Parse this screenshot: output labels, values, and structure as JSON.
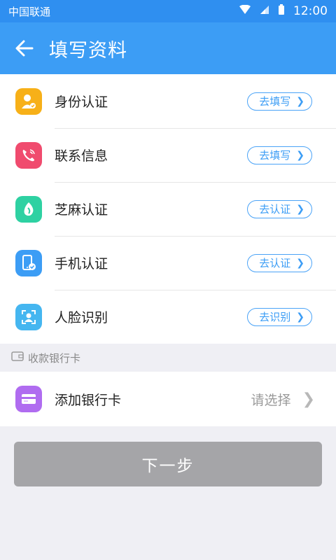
{
  "statusbar": {
    "carrier": "中国联通",
    "time": "12:00"
  },
  "appbar": {
    "title": "填写资料"
  },
  "items": [
    {
      "label": "身份认证",
      "action": "去填写",
      "icon": "id-card-icon",
      "color": "#f7b018"
    },
    {
      "label": "联系信息",
      "action": "去填写",
      "icon": "phone-contact-icon",
      "color": "#f04b6e"
    },
    {
      "label": "芝麻认证",
      "action": "去认证",
      "icon": "sesame-icon",
      "color": "#2ed1a2"
    },
    {
      "label": "手机认证",
      "action": "去认证",
      "icon": "mobile-verify-icon",
      "color": "#3c9df5"
    },
    {
      "label": "人脸识别",
      "action": "去识别",
      "icon": "face-id-icon",
      "color": "#45b6f0"
    }
  ],
  "bank_section": {
    "title": "收款银行卡"
  },
  "bank_row": {
    "label": "添加银行卡",
    "value": "请选择",
    "icon": "bank-card-icon",
    "color": "#b06cf0"
  },
  "next_button": {
    "label": "下一步"
  }
}
